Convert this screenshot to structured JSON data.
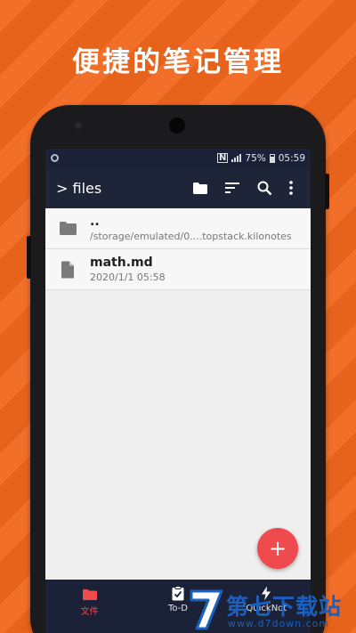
{
  "banner": {
    "headline": "便捷的笔记管理"
  },
  "status_bar": {
    "battery": "75%",
    "time": "05:59"
  },
  "toolbar": {
    "title": "> files",
    "icons": [
      "folder-icon",
      "sort-icon",
      "search-icon",
      "more-vert-icon"
    ]
  },
  "files": [
    {
      "name": "..",
      "detail": "/storage/emulated/0....topstack.kilonotes",
      "icon": "folder-icon"
    },
    {
      "name": "math.md",
      "detail": "2020/1/1 05:58",
      "icon": "file-icon"
    }
  ],
  "fab": {
    "label": "+"
  },
  "bottom_nav": [
    {
      "label": "文件",
      "icon": "folder-icon",
      "active": true
    },
    {
      "label": "To-D",
      "icon": "todo-clipboard-icon",
      "active": false
    },
    {
      "label": "QuickNot",
      "icon": "lightning-icon",
      "active": false
    }
  ],
  "watermark": {
    "text": "第七下载站",
    "url": "www.d7down.com"
  },
  "colors": {
    "background": "#f0671d",
    "toolbar": "#1f2539",
    "accent": "#ef4a4e"
  }
}
